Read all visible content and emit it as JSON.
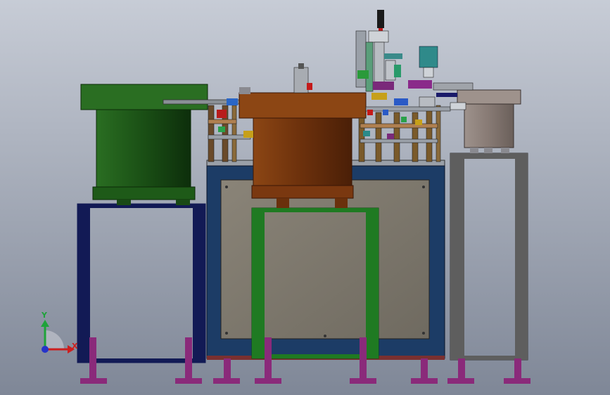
{
  "viewport": {
    "background_top": "#c7ccd6",
    "background_bottom": "#7f8797"
  },
  "triad": {
    "x_label": "X",
    "y_label": "Y",
    "x_color": "#cc1f1f",
    "y_color": "#1fa33a",
    "z_color": "#2633c9"
  },
  "parts": {
    "bowl_feeder_left": {
      "color": "#1f5c1a"
    },
    "bowl_feeder_center": {
      "color": "#7a3a12"
    },
    "bowl_feeder_right": {
      "color": "#8a7f7a"
    },
    "stand_left": {
      "color": "#121a55"
    },
    "stand_center": {
      "color": "#1f7a22"
    },
    "stand_right": {
      "color": "#5a5a5a"
    },
    "main_cabinet": {
      "color": "#1c3c66"
    },
    "feet": {
      "color": "#8a2a7a"
    }
  }
}
